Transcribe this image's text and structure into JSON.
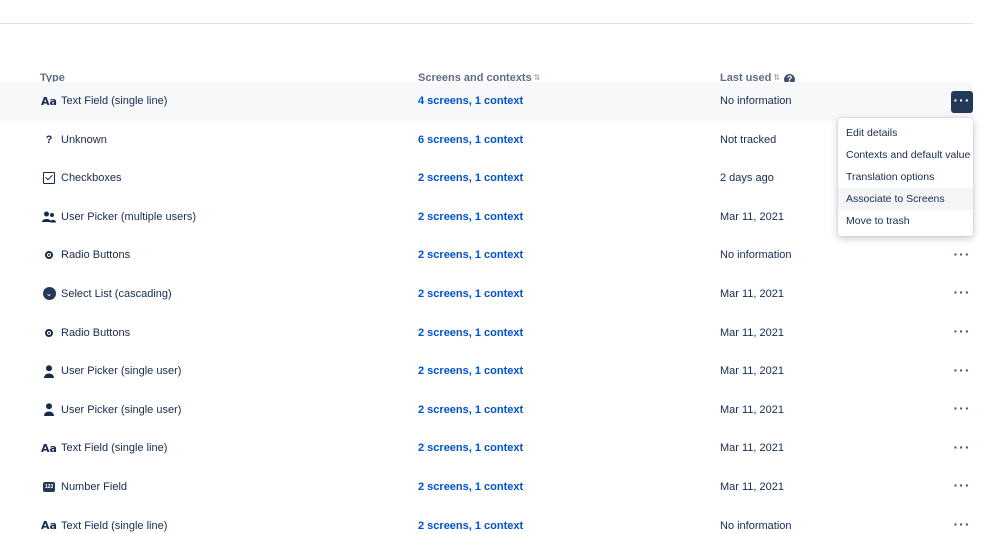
{
  "header": {
    "type": "Type",
    "screens": "Screens and contexts",
    "last_used": "Last used"
  },
  "rows": [
    {
      "icon": "text-field-icon",
      "type": "Text Field (single line)",
      "screens": "4 screens, 1 context",
      "last_used": "No information"
    },
    {
      "icon": "unknown-icon",
      "type": "Unknown",
      "screens": "6 screens, 1 context",
      "last_used": "Not tracked"
    },
    {
      "icon": "checkbox-icon",
      "type": "Checkboxes",
      "screens": "2 screens, 1 context",
      "last_used": "2 days ago"
    },
    {
      "icon": "users-icon",
      "type": "User Picker (multiple users)",
      "screens": "2 screens, 1 context",
      "last_used": "Mar 11, 2021"
    },
    {
      "icon": "radio-icon",
      "type": "Radio Buttons",
      "screens": "2 screens, 1 context",
      "last_used": "No information"
    },
    {
      "icon": "select-list-icon",
      "type": "Select List (cascading)",
      "screens": "2 screens, 1 context",
      "last_used": "Mar 11, 2021"
    },
    {
      "icon": "radio-icon",
      "type": "Radio Buttons",
      "screens": "2 screens, 1 context",
      "last_used": "Mar 11, 2021"
    },
    {
      "icon": "user-icon",
      "type": "User Picker (single user)",
      "screens": "2 screens, 1 context",
      "last_used": "Mar 11, 2021"
    },
    {
      "icon": "user-icon",
      "type": "User Picker (single user)",
      "screens": "2 screens, 1 context",
      "last_used": "Mar 11, 2021"
    },
    {
      "icon": "text-field-icon",
      "type": "Text Field (single line)",
      "screens": "2 screens, 1 context",
      "last_used": "Mar 11, 2021"
    },
    {
      "icon": "number-field-icon",
      "type": "Number Field",
      "screens": "2 screens, 1 context",
      "last_used": "Mar 11, 2021"
    },
    {
      "icon": "text-field-icon",
      "type": "Text Field (single line)",
      "screens": "2 screens, 1 context",
      "last_used": "No information"
    }
  ],
  "icons": {
    "text_field": "Aa",
    "unknown": "?",
    "select_list": "⌄",
    "number_field": "123"
  },
  "dropdown": {
    "items": [
      {
        "label": "Edit details"
      },
      {
        "label": "Contexts and default value"
      },
      {
        "label": "Translation options"
      },
      {
        "label": "Associate to Screens"
      },
      {
        "label": "Move to trash"
      }
    ]
  },
  "colors": {
    "link": "#0052cc",
    "text": "#172b4d",
    "active_button": "#253858",
    "header_text": "#5e6c84"
  }
}
